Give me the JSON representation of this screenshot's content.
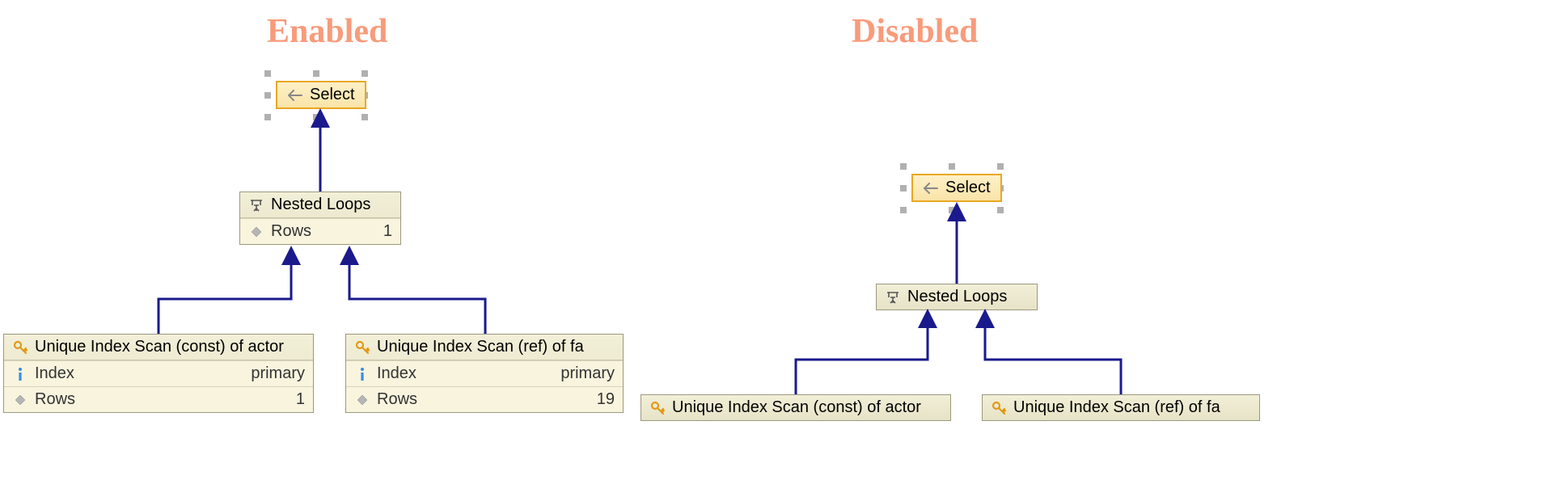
{
  "left": {
    "title": "Enabled",
    "select": {
      "label": "Select"
    },
    "nested_loops": {
      "label": "Nested Loops",
      "rows_label": "Rows",
      "rows_value": "1"
    },
    "scan_left": {
      "label": "Unique Index Scan (const) of actor",
      "index_label": "Index",
      "index_value": "primary",
      "rows_label": "Rows",
      "rows_value": "1"
    },
    "scan_right": {
      "label": "Unique Index Scan (ref) of fa",
      "index_label": "Index",
      "index_value": "primary",
      "rows_label": "Rows",
      "rows_value": "19"
    }
  },
  "right": {
    "title": "Disabled",
    "select": {
      "label": "Select"
    },
    "nested_loops": {
      "label": "Nested Loops"
    },
    "scan_left": {
      "label": "Unique Index Scan (const) of actor"
    },
    "scan_right": {
      "label": "Unique Index Scan (ref) of fa"
    }
  },
  "colors": {
    "title": "#f89b7b",
    "connector": "#1a1a8c",
    "node_border": "#9b9880",
    "select_border": "#e8a822"
  }
}
